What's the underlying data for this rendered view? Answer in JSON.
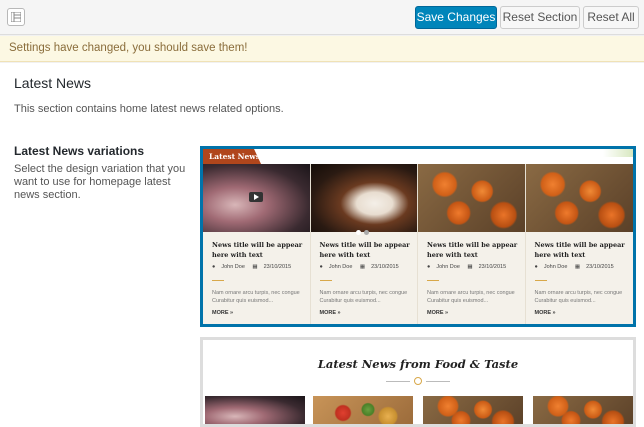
{
  "toolbar": {
    "grid_icon": "layout-icon",
    "save_label": "Save Changes",
    "reset_section_label": "Reset Section",
    "reset_all_label": "Reset All"
  },
  "notice": {
    "text": "Settings have changed, you should save them!",
    "color": "#8a6d3b"
  },
  "section": {
    "title": "Latest News",
    "description": "This section contains home latest news related options."
  },
  "option": {
    "title": "Latest News variations",
    "description": "Select the design variation that you want to use for homepage latest news section."
  },
  "variation1": {
    "label": "Latest News",
    "selected": true,
    "accent": "#0073aa",
    "items": [
      {
        "title": "News title will be appear here with text",
        "author": "John Doe",
        "date": "23/10/2015",
        "excerpt": "Nam ornare arcu turpis, nec congue Curabitur quis euismod...",
        "more": "MORE »",
        "image": "video-hands"
      },
      {
        "title": "News title will be appear here with text",
        "author": "John Doe",
        "date": "23/10/2015",
        "excerpt": "Nam ornare arcu turpis, nec congue Curabitur quis euismod...",
        "more": "MORE »",
        "image": "plated-food"
      },
      {
        "title": "News title will be appear here with text",
        "author": "John Doe",
        "date": "23/10/2015",
        "excerpt": "Nam ornare arcu turpis, nec congue Curabitur quis euismod...",
        "more": "MORE »",
        "image": "pumpkins"
      },
      {
        "title": "News title will be appear here with text",
        "author": "John Doe",
        "date": "23/10/2015",
        "excerpt": "Nam ornare arcu turpis, nec congue Curabitur quis euismod...",
        "more": "MORE »",
        "image": "pumpkins"
      }
    ]
  },
  "variation2": {
    "title": "Latest News from Food & Taste",
    "thumbs": [
      "video-hands",
      "food-salad",
      "pumpkins",
      "pumpkins"
    ]
  }
}
